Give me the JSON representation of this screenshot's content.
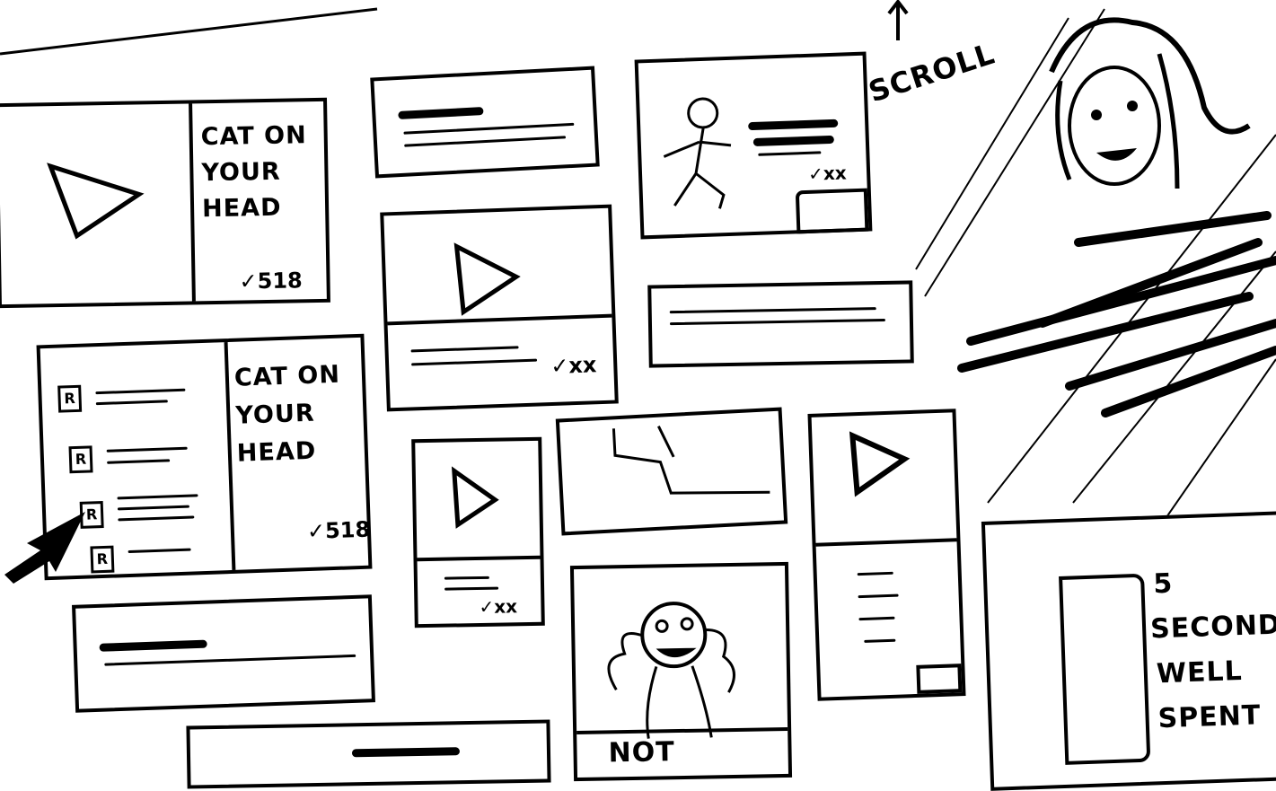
{
  "cards": {
    "video_card_1": {
      "title": "CAT ON YOUR HEAD",
      "count": "✓518"
    },
    "list_card": {
      "title": "CAT ON YOUR HEAD",
      "count": "✓518",
      "avatar_glyph": "R"
    },
    "video_card_2": {
      "count": "✓xx"
    },
    "video_card_3": {
      "count": "✓xx"
    },
    "stick_figure_card": {
      "count": "✓xx"
    },
    "figure_card": {
      "caption": "NOT"
    },
    "promo_card": {
      "lines": [
        "5",
        "SECOND",
        "WELL",
        "SPENT"
      ]
    }
  },
  "scroll_hint": "SCROLL"
}
